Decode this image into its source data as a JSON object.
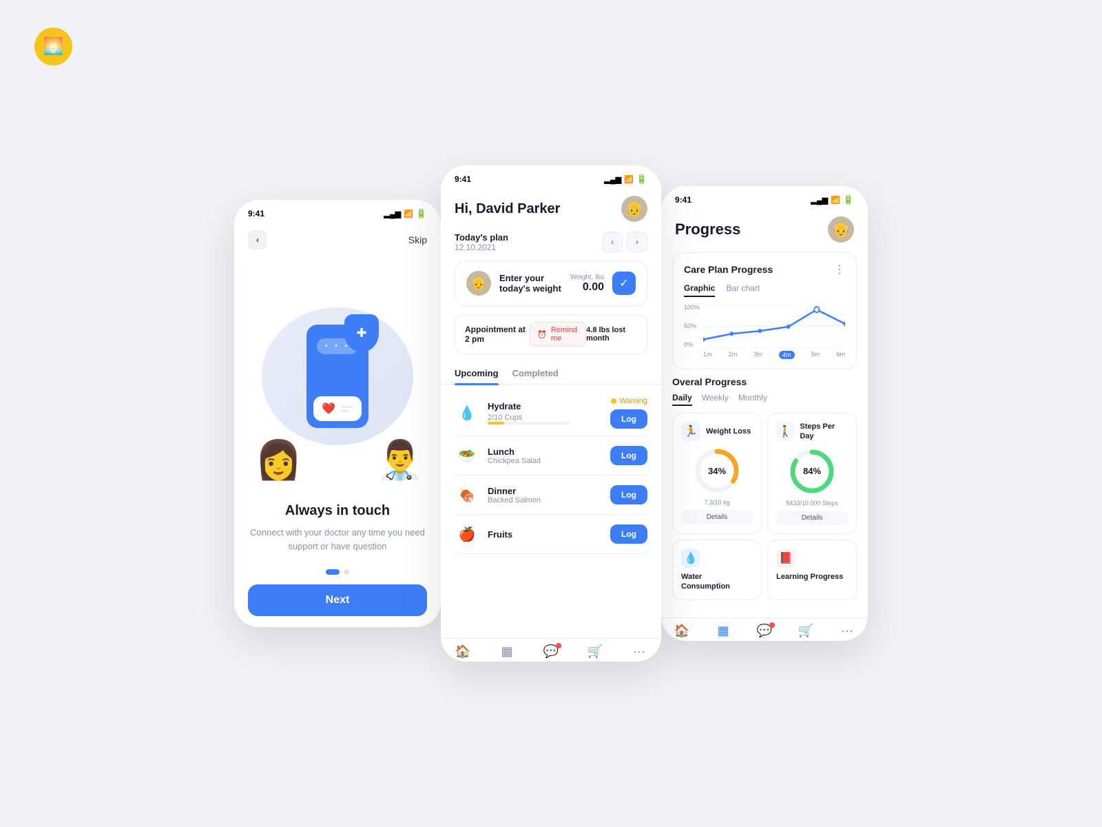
{
  "logo": {
    "icon": "🌞"
  },
  "screen1": {
    "time": "9:41",
    "back_label": "‹",
    "skip_label": "Skip",
    "title": "Always in touch",
    "subtitle": "Connect with your doctor any time you need support or have question",
    "next_label": "Next",
    "dots": [
      true,
      false
    ]
  },
  "screen2": {
    "time": "9:41",
    "greeting": "Hi, David Parker",
    "avatar_emoji": "👴",
    "today_plan_label": "Today's plan",
    "today_plan_date": "12.10.2021",
    "weight_label": "Enter your today's weight",
    "weight_field_label": "Weight, lbs",
    "weight_value": "0.00",
    "appointment_text": "Appointment at 2 pm",
    "remind_label": "Remind me",
    "lbs_lost": "4.8 lbs lost month",
    "tabs": [
      "Upcoming",
      "Completed"
    ],
    "active_tab": "Upcoming",
    "tasks": [
      {
        "name": "Hydrate",
        "icon": "💧",
        "badge": "Warning",
        "cups": "2/10 Cups",
        "progress": 20,
        "has_log": true
      },
      {
        "name": "Lunch",
        "sub": "Chickpea Salad",
        "icon": "🥗",
        "has_log": true
      },
      {
        "name": "Dinner",
        "sub": "Backed Salmon",
        "icon": "🍖",
        "has_log": true
      },
      {
        "name": "Fruits",
        "icon": "🍎",
        "has_log": true
      }
    ],
    "nav_items": [
      {
        "label": "Home",
        "icon": "🏠",
        "active": true
      },
      {
        "label": "Progress",
        "icon": "📊",
        "active": false
      },
      {
        "label": "Chat",
        "icon": "💬",
        "active": false,
        "badge": true
      },
      {
        "label": "Market",
        "icon": "🛒",
        "active": false
      },
      {
        "label": "More",
        "icon": "···",
        "active": false
      }
    ]
  },
  "screen3": {
    "time": "9:41",
    "title": "Progress",
    "avatar_emoji": "👴",
    "care_plan_title": "Care Plan Progress",
    "chart_tabs": [
      "Graphic",
      "Bar chart"
    ],
    "chart_active_tab": "Graphic",
    "chart_y_labels": [
      "100%",
      "50%",
      "0%"
    ],
    "chart_x_labels": [
      "1m",
      "2m",
      "3m",
      "4m",
      "5m",
      "6m"
    ],
    "chart_active_x": "4m",
    "overall_title": "Overal Progress",
    "period_tabs": [
      "Daily",
      "Weekly",
      "Monthly"
    ],
    "active_period": "Daily",
    "progress_cards": [
      {
        "title": "Weight Loss",
        "icon": "🏃",
        "percent": 34,
        "sub": "7.3/10 kg",
        "details_label": "Details",
        "color": "#f5a623"
      },
      {
        "title": "Steps Per Day",
        "icon": "🚶",
        "percent": 84,
        "sub": "8433/10 000 Steps",
        "details_label": "Details",
        "color": "#4cd97b"
      }
    ],
    "mini_cards": [
      {
        "title": "Water Consumption",
        "icon": "💧",
        "icon_bg": "#e8f4ff"
      },
      {
        "title": "Learning Progress",
        "icon": "📕",
        "icon_bg": "#fff0f0"
      }
    ],
    "nav_items": [
      {
        "label": "Home",
        "icon": "🏠",
        "active": false
      },
      {
        "label": "Progress",
        "icon": "📊",
        "active": true
      },
      {
        "label": "Chat",
        "icon": "💬",
        "active": false,
        "badge": true
      },
      {
        "label": "Market",
        "icon": "🛒",
        "active": false
      },
      {
        "label": "More",
        "icon": "···",
        "active": false
      }
    ]
  }
}
